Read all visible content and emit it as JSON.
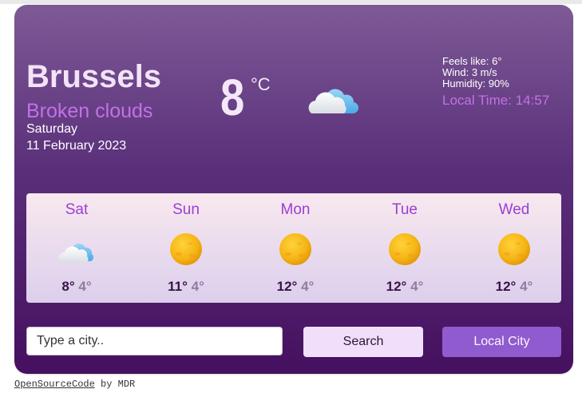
{
  "current": {
    "city": "Brussels",
    "description": "Broken clouds",
    "day": "Saturday",
    "date": "11 February 2023",
    "temperature": "8",
    "unit": "°C",
    "icon": "broken-clouds-icon",
    "feels_like": "Feels like: 6°",
    "wind": "Wind: 3 m/s",
    "humidity": "Humidity: 90%",
    "local_time": "Local Time: 14:57"
  },
  "forecast": [
    {
      "day": "Sat",
      "max": "8°",
      "min": "4°",
      "icon": "clouds-icon"
    },
    {
      "day": "Sun",
      "max": "11°",
      "min": "4°",
      "icon": "sun-icon"
    },
    {
      "day": "Mon",
      "max": "12°",
      "min": "4°",
      "icon": "sun-icon"
    },
    {
      "day": "Tue",
      "max": "12°",
      "min": "4°",
      "icon": "sun-icon"
    },
    {
      "day": "Wed",
      "max": "12°",
      "min": "4°",
      "icon": "sun-icon"
    }
  ],
  "search": {
    "placeholder": "Type a city..",
    "value": "",
    "search_label": "Search",
    "local_city_label": "Local City"
  },
  "footer": {
    "link_text": "OpenSourceCode",
    "suffix": " by MDR"
  },
  "colors": {
    "accent": "#c271e6",
    "day_label": "#9b3fd1",
    "local_button": "#8f5bcf",
    "search_button": "#f1defa"
  }
}
